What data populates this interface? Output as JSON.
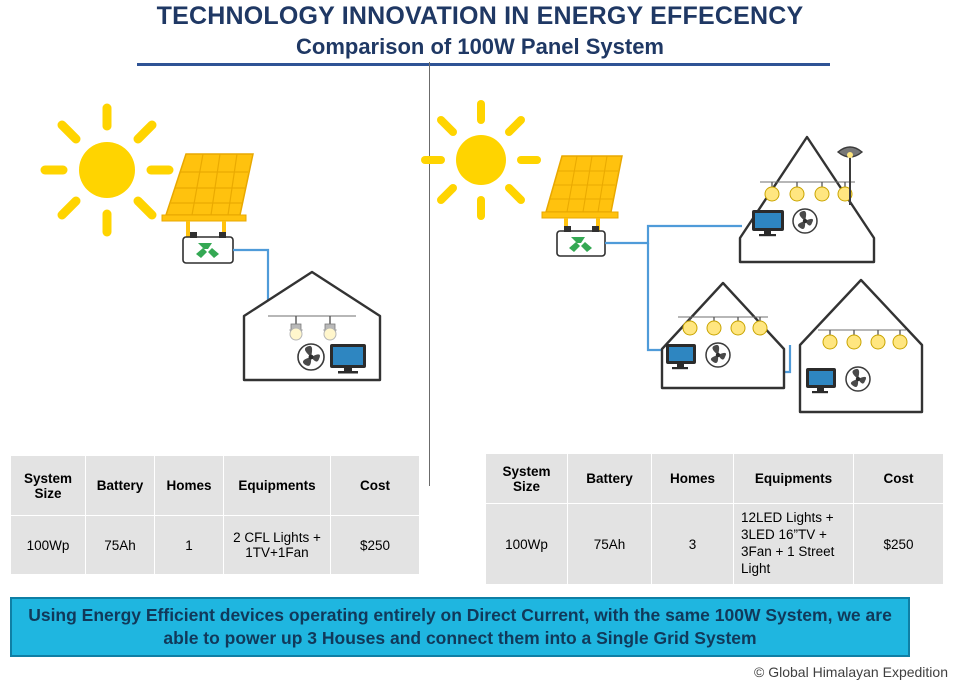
{
  "title": {
    "line1": "TECHNOLOGY INNOVATION IN ENERGY EFFECENCY",
    "line2": "Comparison of 100W Panel System"
  },
  "colors": {
    "title": "#1F3864",
    "rule": "#2E5395",
    "banner_bg": "#1FB6E0",
    "banner_text": "#11395A",
    "table_cell_bg": "#E3E3E3",
    "sun": "#FFD400",
    "panel": "#FFC20E",
    "wire": "#4F9BD9",
    "bulb": "#FFE680",
    "screen": "#2E86C1"
  },
  "left_diagram": {
    "icons": [
      "sun-icon",
      "solar-panel-icon",
      "battery-icon",
      "house-icon",
      "cfl-bulb-icon",
      "fan-icon",
      "tv-icon",
      "wire-line"
    ],
    "house_count": 1
  },
  "right_diagram": {
    "icons": [
      "sun-icon",
      "solar-panel-icon",
      "battery-icon",
      "house-icon",
      "led-bulb-icon",
      "street-light-icon",
      "fan-icon",
      "tv-icon",
      "wire-line"
    ],
    "house_count": 3
  },
  "table_left": {
    "headers": [
      "System Size",
      "Battery",
      "Homes",
      "Equipments",
      "Cost"
    ],
    "rows": [
      [
        "100Wp",
        "75Ah",
        "1",
        "2 CFL Lights + 1TV+1Fan",
        "$250"
      ]
    ]
  },
  "table_right": {
    "headers": [
      "System Size",
      "Battery",
      "Homes",
      "Equipments",
      "Cost"
    ],
    "rows": [
      [
        "100Wp",
        "75Ah",
        "3",
        "12LED Lights + 3LED 16”TV + 3Fan + 1 Street Light",
        "$250"
      ]
    ]
  },
  "banner": {
    "text": "Using Energy Efficient devices operating entirely on Direct Current, with the same 100W System, we are able to power up 3 Houses and connect them into a Single Grid System"
  },
  "credit": "© Global Himalayan Expedition"
}
